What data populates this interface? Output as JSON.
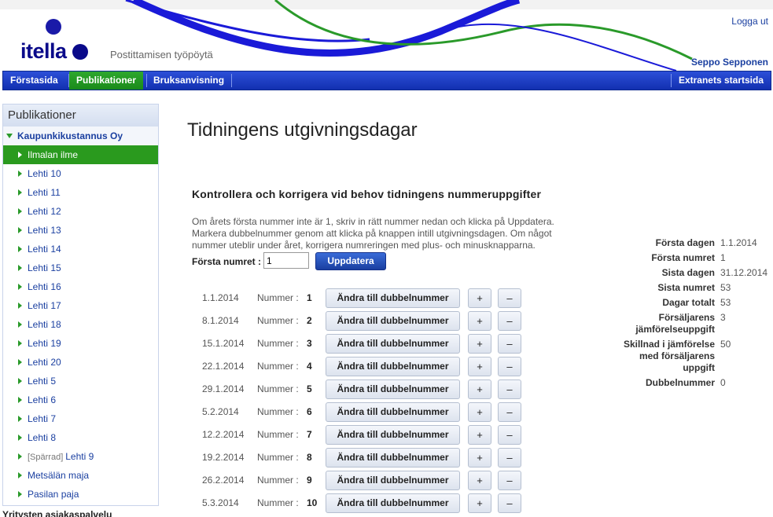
{
  "header": {
    "logo_text": "itella",
    "subtitle": "Postittamisen työpöytä",
    "logout_label": "Logga ut",
    "user_name": "Seppo Sepponen",
    "brand_color": "#0a0a8a"
  },
  "nav": {
    "items": [
      {
        "label": "Förstasida",
        "active": false
      },
      {
        "label": "Publikationer",
        "active": true
      },
      {
        "label": "Bruksanvisning",
        "active": false
      }
    ],
    "right_label": "Extranets startsida"
  },
  "sidebar": {
    "title": "Publikationer",
    "company": "Kaupunkikustannus Oy",
    "items": [
      {
        "label": "Ilmalan ilme",
        "active": true
      },
      {
        "label": "Lehti 10"
      },
      {
        "label": "Lehti 11"
      },
      {
        "label": "Lehti 12"
      },
      {
        "label": "Lehti 13"
      },
      {
        "label": "Lehti 14"
      },
      {
        "label": "Lehti 15"
      },
      {
        "label": "Lehti 16"
      },
      {
        "label": "Lehti 17"
      },
      {
        "label": "Lehti 18"
      },
      {
        "label": "Lehti 19"
      },
      {
        "label": "Lehti 20"
      },
      {
        "label": "Lehti 5"
      },
      {
        "label": "Lehti 6"
      },
      {
        "label": "Lehti 7"
      },
      {
        "label": "Lehti 8"
      },
      {
        "label": "Lehti 9",
        "locked": "[Spärrad]"
      },
      {
        "label": "Metsälän maja"
      },
      {
        "label": "Pasilan paja"
      }
    ],
    "footer": "Yritysten asiakaspalvelu"
  },
  "main": {
    "title": "Tidningens utgivningsdagar",
    "section_heading": "Kontrollera och korrigera vid behov tidningens nummeruppgifter",
    "intro": "Om årets första nummer inte är 1, skriv in rätt nummer nedan och klicka på Uppdatera. Markera dubbelnummer genom att klicka på knappen intill utgivningsdagen. Om något nummer uteblir under året, korrigera numreringen med plus- och minusknapparna.",
    "first_number_label": "Första numret :",
    "first_number_value": "1",
    "update_label": "Uppdatera",
    "number_label": "Nummer :",
    "double_label": "Ändra till dubbelnummer",
    "plus_label": "+",
    "minus_label": "–",
    "rows": [
      {
        "date": "1.1.2014",
        "number": "1"
      },
      {
        "date": "8.1.2014",
        "number": "2"
      },
      {
        "date": "15.1.2014",
        "number": "3"
      },
      {
        "date": "22.1.2014",
        "number": "4"
      },
      {
        "date": "29.1.2014",
        "number": "5"
      },
      {
        "date": "5.2.2014",
        "number": "6"
      },
      {
        "date": "12.2.2014",
        "number": "7"
      },
      {
        "date": "19.2.2014",
        "number": "8"
      },
      {
        "date": "26.2.2014",
        "number": "9"
      },
      {
        "date": "5.3.2014",
        "number": "10"
      }
    ]
  },
  "stats": [
    {
      "key": "Första dagen",
      "value": "1.1.2014"
    },
    {
      "key": "Första numret",
      "value": "1"
    },
    {
      "key": "Sista dagen",
      "value": "31.12.2014"
    },
    {
      "key": "Sista numret",
      "value": "53"
    },
    {
      "key": "Dagar totalt",
      "value": "53"
    },
    {
      "key": "Försäljarens jämförelseuppgift",
      "value": "3"
    },
    {
      "key": "Skillnad i jämförelse med försäljarens uppgift",
      "value": "50"
    },
    {
      "key": "Dubbelnummer",
      "value": "0"
    }
  ]
}
